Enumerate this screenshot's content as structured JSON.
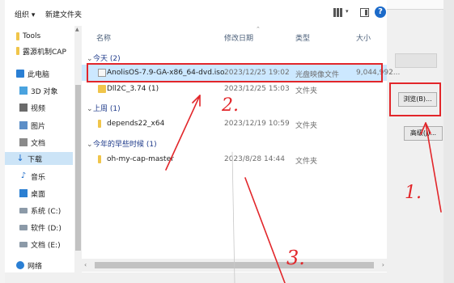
{
  "toolbar": {
    "organize": "组织 ▾",
    "new_folder": "新建文件夹",
    "help": "?"
  },
  "nav": {
    "items": [
      {
        "label": "Tools",
        "icon": "folder-icon"
      },
      {
        "label": "露源机制CAP",
        "icon": "folder-icon"
      },
      {
        "label": "此电脑",
        "icon": "this-pc-icon"
      },
      {
        "label": "3D 对象",
        "icon": "3d-objects-icon"
      },
      {
        "label": "视频",
        "icon": "video-icon"
      },
      {
        "label": "图片",
        "icon": "pictures-icon"
      },
      {
        "label": "文档",
        "icon": "documents-icon"
      },
      {
        "label": "下载",
        "icon": "download-icon"
      },
      {
        "label": "音乐",
        "icon": "music-icon"
      },
      {
        "label": "桌面",
        "icon": "desktop-icon"
      },
      {
        "label": "系统 (C:)",
        "icon": "drive-icon"
      },
      {
        "label": "软件 (D:)",
        "icon": "drive-icon"
      },
      {
        "label": "文档 (E:)",
        "icon": "drive-icon"
      },
      {
        "label": "网络",
        "icon": "network-icon"
      }
    ]
  },
  "columns": {
    "name": "名称",
    "modified": "修改日期",
    "type": "类型",
    "size": "大小"
  },
  "groups": {
    "today": "今天 (2)",
    "last_week": "上周 (1)",
    "earlier_this_year": "今年的早些时候 (1)"
  },
  "files": [
    {
      "name": "AnolisOS-7.9-GA-x86_64-dvd.iso",
      "modified": "2023/12/25 19:02",
      "type": "光盘映像文件",
      "size": "9,044,992...",
      "selected": true
    },
    {
      "name": "Dll2C_3.74 (1)",
      "modified": "2023/12/25 15:03",
      "type": "文件夹",
      "size": ""
    },
    {
      "name": "depends22_x64",
      "modified": "2023/12/19 10:59",
      "type": "文件夹",
      "size": ""
    },
    {
      "name": "oh-my-cap-master",
      "modified": "2023/8/28 14:44",
      "type": "文件夹",
      "size": ""
    }
  ],
  "background_window": {
    "browse_button": "浏览(B)...",
    "advanced_button": "高级(J)..."
  },
  "annotations": {
    "step1": "1.",
    "step2": "2.",
    "step3": "3.",
    "color": "#e2262a"
  }
}
